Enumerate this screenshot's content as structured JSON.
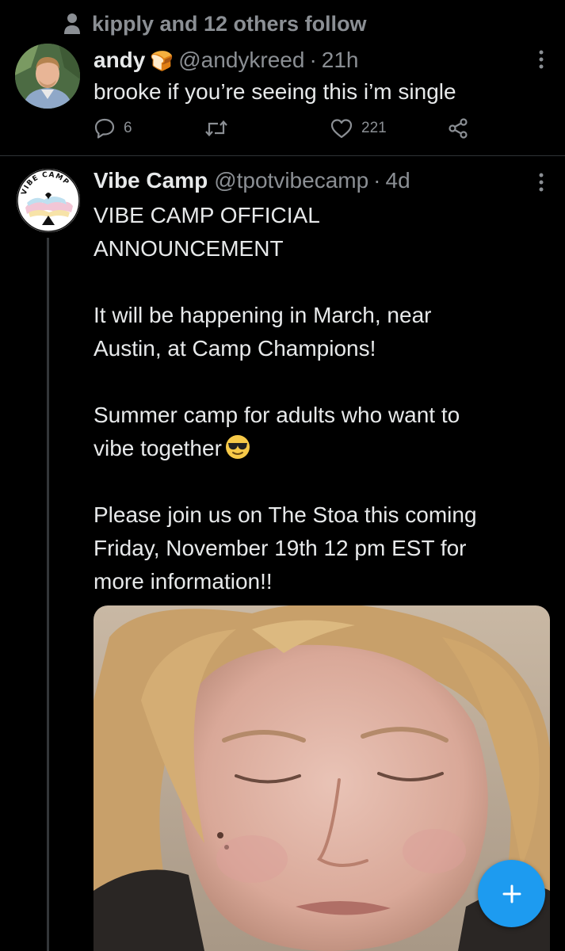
{
  "social_context": {
    "icon": "person-icon",
    "text": "kipply and 12 others follow"
  },
  "tweet1": {
    "name": "andy",
    "name_emoji": "🍞",
    "handle": "@andykreed",
    "separator": "·",
    "time": "21h",
    "text": "brooke if you’re seeing this i’m single",
    "reply_count": "6",
    "retweet_count": "",
    "like_count": "221"
  },
  "tweet2": {
    "name": "Vibe Camp",
    "handle": "@tpotvibecamp",
    "separator": "·",
    "time": "4d",
    "avatar_text": "VIBE CAMP",
    "paragraphs": [
      "VIBE CAMP OFFICIAL\nANNOUNCEMENT",
      "It will be happening in March, near\nAustin, at Camp Champions!",
      "Summer camp for adults who want to\nvibe together",
      "Please join us on The Stoa this coming\nFriday, November 19th 12 pm EST for\nmore information!!"
    ]
  },
  "fab": {
    "icon": "plus-icon",
    "label": "+"
  },
  "colors": {
    "background": "#000000",
    "text": "#e7e9ea",
    "muted": "#8b8f94",
    "accent": "#1d9bf0",
    "divider": "#2f3336"
  }
}
